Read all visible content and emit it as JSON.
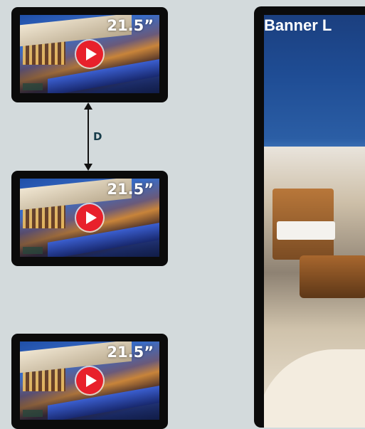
{
  "screens": [
    {
      "size_label": "21.5”",
      "icon": "play-icon"
    },
    {
      "size_label": "21.5”",
      "icon": "play-icon"
    },
    {
      "size_label": "21.5”",
      "icon": "play-icon"
    }
  ],
  "distance": {
    "label": "D",
    "icon": "double-arrow-icon"
  },
  "banner": {
    "title": "Banner L"
  },
  "colors": {
    "background": "#d3dadc",
    "bezel": "#0b0b0b",
    "play_button": "#e8202b",
    "distance_label": "#173c4a"
  }
}
